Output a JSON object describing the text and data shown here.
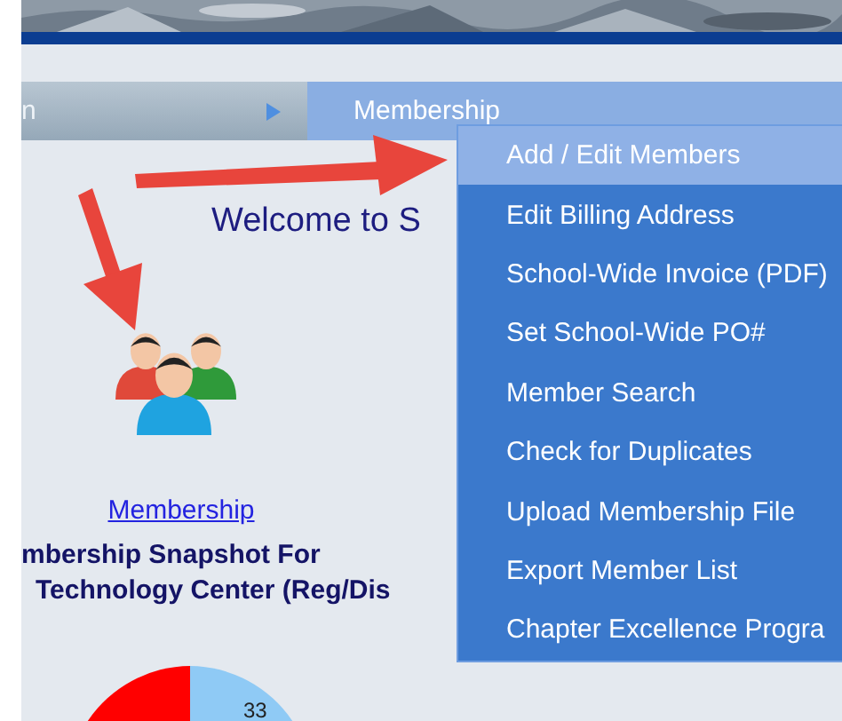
{
  "nav": {
    "items": [
      {
        "label": "n",
        "selected": false
      },
      {
        "label": "Membership",
        "selected": true
      }
    ]
  },
  "menu": {
    "items": [
      {
        "label": "Add / Edit Members",
        "selected": true
      },
      {
        "label": "Edit Billing Address",
        "selected": false
      },
      {
        "label": "School-Wide Invoice (PDF)",
        "selected": false
      },
      {
        "label": "Set School-Wide PO#",
        "selected": false
      },
      {
        "label": "Member Search",
        "selected": false
      },
      {
        "label": "Check for Duplicates",
        "selected": false
      },
      {
        "label": "Upload Membership File",
        "selected": false
      },
      {
        "label": "Export Member List",
        "selected": false
      },
      {
        "label": "Chapter Excellence Progra",
        "selected": false
      }
    ]
  },
  "welcome": "Welcome to S",
  "tile": {
    "label": "Membership"
  },
  "snapshot": {
    "lines": [
      "mbership Snapshot For",
      "Technology Center (Reg/Dis"
    ]
  },
  "pie": {
    "label": "33"
  }
}
